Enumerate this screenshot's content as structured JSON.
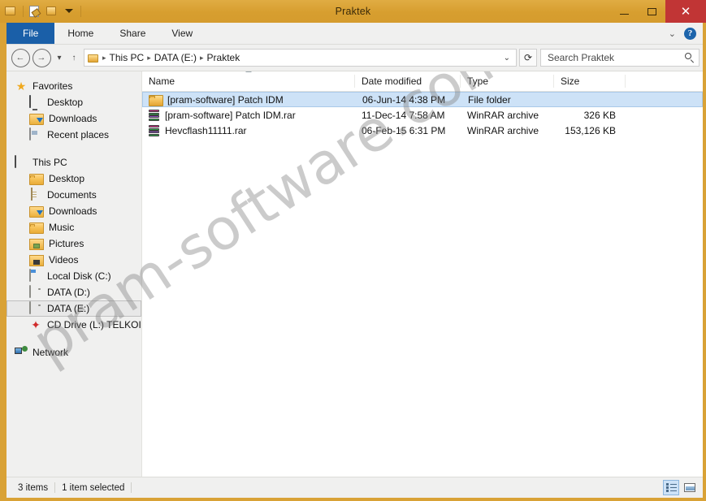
{
  "window": {
    "title": "Praktek",
    "quick_access": [
      {
        "name": "folder-properties-icon",
        "label": "Properties"
      },
      {
        "name": "new-folder-icon",
        "label": "New folder"
      },
      {
        "name": "customize-quick-access-icon",
        "label": "Customize Quick Access Toolbar"
      }
    ],
    "controls": {
      "minimize": "–",
      "maximize": "□",
      "close": "✕"
    }
  },
  "ribbon": {
    "tabs": [
      {
        "label": "File",
        "active": true
      },
      {
        "label": "Home",
        "active": false
      },
      {
        "label": "Share",
        "active": false
      },
      {
        "label": "View",
        "active": false
      }
    ],
    "expand_icon": "⌄",
    "help_label": "?"
  },
  "address": {
    "back_icon": "←",
    "forward_icon": "→",
    "recent_icon": "▾",
    "up_icon": "↑",
    "breadcrumb": [
      "This PC",
      "DATA (E:)",
      "Praktek"
    ],
    "separator": "▸",
    "dropdown_icon": "⌄",
    "refresh_icon": "⟳"
  },
  "search": {
    "placeholder": "Search Praktek",
    "value": "",
    "icon": "search-icon"
  },
  "sidebar": {
    "groups": [
      {
        "header": {
          "label": "Favorites",
          "icon": "star-icon"
        },
        "items": [
          {
            "label": "Desktop",
            "icon": "monitor-icon"
          },
          {
            "label": "Downloads",
            "icon": "downloads-folder-icon"
          },
          {
            "label": "Recent places",
            "icon": "recent-places-icon"
          }
        ]
      },
      {
        "header": {
          "label": "This PC",
          "icon": "computer-icon"
        },
        "items": [
          {
            "label": "Desktop",
            "icon": "desktop-folder-icon"
          },
          {
            "label": "Documents",
            "icon": "documents-icon"
          },
          {
            "label": "Downloads",
            "icon": "downloads-folder-icon"
          },
          {
            "label": "Music",
            "icon": "music-folder-icon"
          },
          {
            "label": "Pictures",
            "icon": "pictures-folder-icon"
          },
          {
            "label": "Videos",
            "icon": "videos-folder-icon"
          },
          {
            "label": "Local Disk (C:)",
            "icon": "local-disk-icon"
          },
          {
            "label": "DATA (D:)",
            "icon": "drive-icon"
          },
          {
            "label": "DATA (E:)",
            "icon": "drive-icon",
            "selected": true
          },
          {
            "label": "CD Drive (L:) TELKOI",
            "icon": "cd-drive-icon"
          }
        ]
      },
      {
        "header": {
          "label": "Network",
          "icon": "network-icon"
        },
        "items": []
      }
    ]
  },
  "filelist": {
    "columns": [
      {
        "label": "Name",
        "sorted": true,
        "sort_direction": "asc"
      },
      {
        "label": "Date modified",
        "sorted": false
      },
      {
        "label": "Type",
        "sorted": false
      },
      {
        "label": "Size",
        "sorted": false
      }
    ],
    "rows": [
      {
        "name": "[pram-software] Patch IDM",
        "date_modified": "06-Jun-14 4:38 PM",
        "type": "File folder",
        "size": "",
        "icon": "folder-icon",
        "selected": true
      },
      {
        "name": "[pram-software] Patch IDM.rar",
        "date_modified": "11-Dec-14 7:58 AM",
        "type": "WinRAR archive",
        "size": "326 KB",
        "icon": "winrar-archive-icon",
        "selected": false
      },
      {
        "name": "Hevcflash11111.rar",
        "date_modified": "06-Feb-15 6:31 PM",
        "type": "WinRAR archive",
        "size": "153,126 KB",
        "icon": "winrar-archive-icon",
        "selected": false
      }
    ]
  },
  "watermark": {
    "text": "pram-software.com"
  },
  "statusbar": {
    "item_count": "3 items",
    "selection": "1 item selected",
    "views": [
      {
        "name": "details-view",
        "label": "Details view",
        "active": true
      },
      {
        "name": "large-icons-view",
        "label": "Large icons view",
        "active": false
      }
    ]
  },
  "theme": {
    "titlebar": "#d9a236",
    "accent_file_tab": "#1a5fa8",
    "selection": "#cde2f7",
    "close_button": "#c13535"
  }
}
